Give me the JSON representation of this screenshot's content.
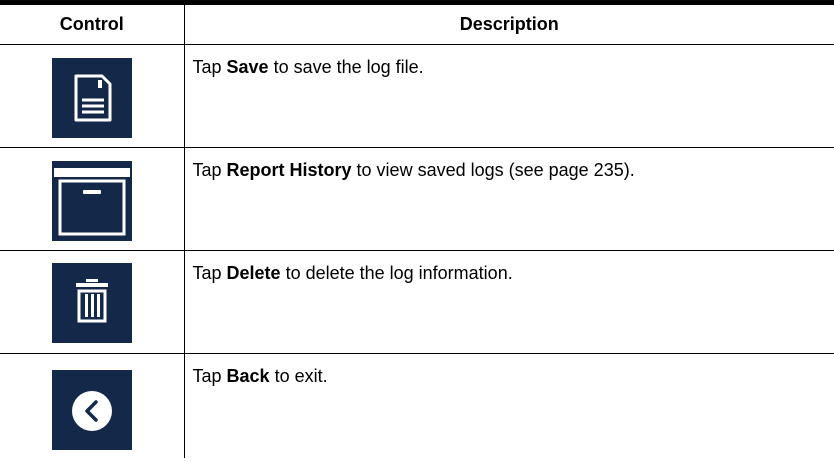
{
  "table": {
    "headers": {
      "control": "Control",
      "description": "Description"
    },
    "rows": [
      {
        "icon": "save-icon",
        "pre": "Tap ",
        "bold": "Save",
        "post": " to save the log file."
      },
      {
        "icon": "archive-box-icon",
        "pre": "Tap ",
        "bold": "Report History",
        "post": " to view saved logs (see page 235)."
      },
      {
        "icon": "trash-icon",
        "pre": "Tap ",
        "bold": "Delete",
        "post": " to delete the log information."
      },
      {
        "icon": "back-arrow-icon",
        "pre": "Tap ",
        "bold": "Back",
        "post": " to exit."
      }
    ]
  },
  "colors": {
    "icon_background": "#14294a",
    "icon_foreground": "#ffffff",
    "rule": "#000000"
  }
}
